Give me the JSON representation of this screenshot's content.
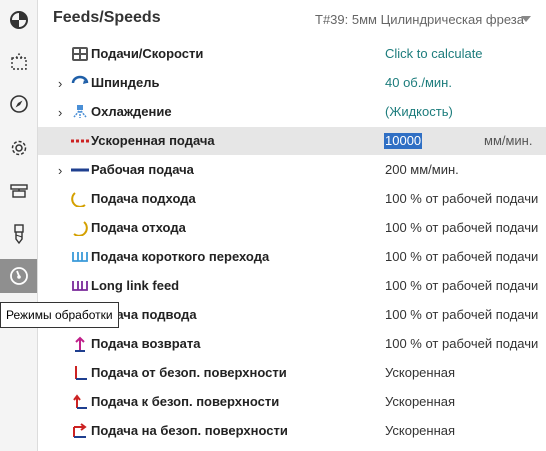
{
  "sidebar": {
    "tooltip": "Режимы обработки",
    "items": [
      {
        "icon": "pie-chart-icon"
      },
      {
        "icon": "selection-box-icon"
      },
      {
        "icon": "compass-icon"
      },
      {
        "icon": "gear-icon"
      },
      {
        "icon": "machine-icon"
      },
      {
        "icon": "drill-tool-icon"
      },
      {
        "icon": "speed-gauge-icon",
        "active": true
      }
    ]
  },
  "header": {
    "title": "Feeds/Speeds",
    "tool": "T#39: 5мм Цилиндрическая фреза"
  },
  "rows": [
    {
      "label": "Подачи/Скорости",
      "value": "Click to calculate",
      "icon": "calculator-icon"
    },
    {
      "label": "Шпиндель",
      "value": "40 об./мин.",
      "icon": "spindle-icon",
      "expand": "›"
    },
    {
      "label": "Охлаждение",
      "value": "(Жидкость)",
      "icon": "coolant-icon",
      "expand": "›"
    },
    {
      "label": "Ускоренная подача",
      "value": "10000",
      "unit": "мм/мин.",
      "icon": "rapid-feed-icon"
    },
    {
      "label": "Рабочая подача",
      "value": "200 мм/мин.",
      "icon": "cutting-feed-icon",
      "expand": "›"
    },
    {
      "label": "Подача подхода",
      "value": "100 % от рабочей подачи",
      "icon": "lead-in-icon"
    },
    {
      "label": "Подача отхода",
      "value": "100 % от рабочей подачи",
      "icon": "lead-out-icon"
    },
    {
      "label": "Подача короткого перехода",
      "value": "100 % от рабочей подачи",
      "icon": "short-link-icon"
    },
    {
      "label": "Long link feed",
      "value": "100 % от рабочей подачи",
      "icon": "long-link-icon"
    },
    {
      "label": "Подача подвода",
      "value": "100 % от рабочей подачи",
      "icon": "approach-icon"
    },
    {
      "label": "Подача возврата",
      "value": "100 % от рабочей подачи",
      "icon": "retract-icon"
    },
    {
      "label": "Подача от безоп. поверхности",
      "value": "Ускоренная",
      "icon": "from-safe-plane-icon"
    },
    {
      "label": "Подача к безоп. поверхности",
      "value": "Ускоренная",
      "icon": "to-safe-plane-icon"
    },
    {
      "label": "Подача на безоп. поверхности",
      "value": "Ускоренная",
      "icon": "on-safe-plane-icon"
    }
  ],
  "colors": {
    "link": "#1c7c7c",
    "selection": "#2f6fc4",
    "rapid": "#cc2222",
    "feed": "#1f3f8f",
    "arc": "#d4a000",
    "link_icon": "#3a9ad9",
    "long_link_icon": "#7a2a9a"
  }
}
